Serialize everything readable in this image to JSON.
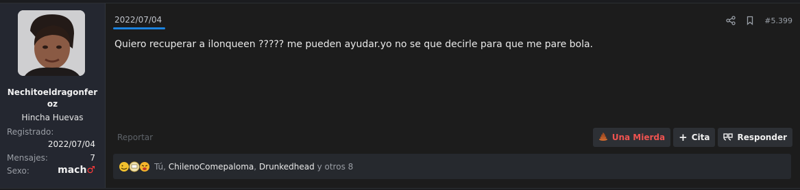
{
  "post": {
    "date": "2022/07/04",
    "number": "#5.399",
    "content": "Quiero recuperar a ilonqueen ????? me pueden ayudar.yo no se que decirle para que me pare bola.",
    "report_label": "Reportar"
  },
  "user": {
    "name": "Nechitoeldragonferoz",
    "title": "Hincha Huevas",
    "registered_label": "Registrado:",
    "registered_value": "2022/07/04",
    "messages_label": "Mensajes:",
    "messages_value": "7",
    "sex_label": "Sexo:",
    "sex_value": "mach",
    "sex_symbol": "♂"
  },
  "actions": {
    "una_mierda": "Una Mierda",
    "cita": "Cita",
    "responder": "Responder"
  },
  "reactions": {
    "you": "Tú,",
    "user1": "ChilenoComepaloma",
    "sep": ",",
    "user2": "Drunkedhead",
    "others": "y otros 8"
  },
  "icons": {
    "share": "share-icon",
    "bookmark": "bookmark-icon",
    "poop": "poop-icon",
    "plus": "plus-icon",
    "reply": "quote-icon"
  },
  "colors": {
    "accent": "#1b84e0",
    "danger": "#ef5350"
  }
}
